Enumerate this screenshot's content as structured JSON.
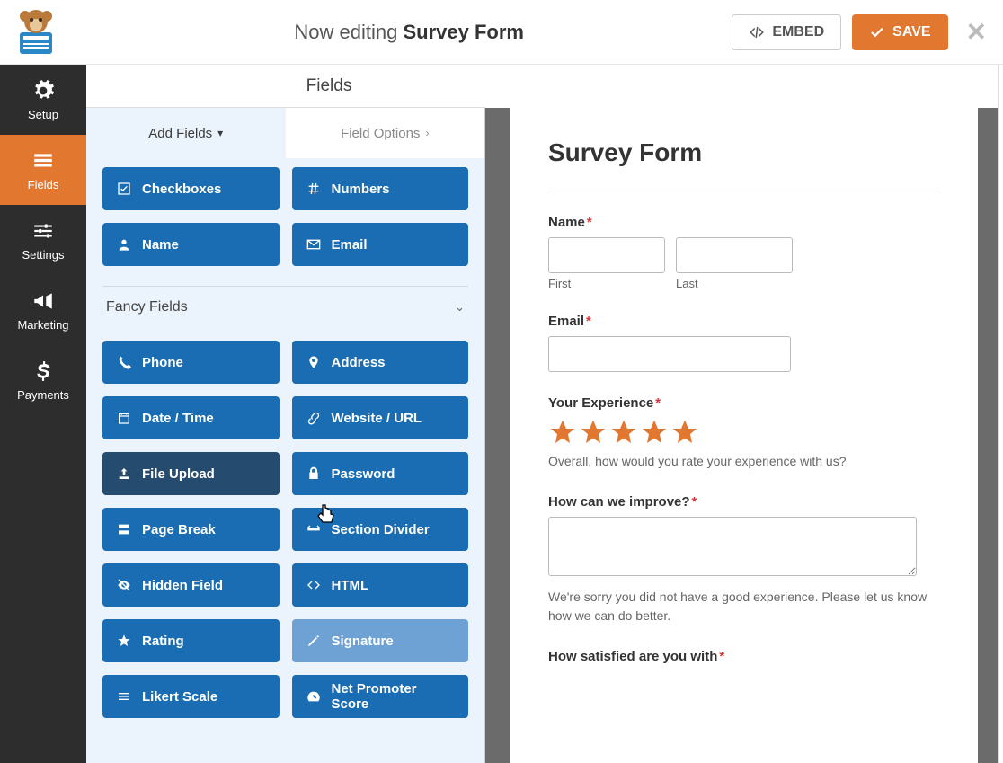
{
  "topbar": {
    "editing_prefix": "Now editing ",
    "editing_name": "Survey Form",
    "embed": "EMBED",
    "save": "SAVE"
  },
  "leftnav": [
    {
      "key": "setup",
      "label": "Setup"
    },
    {
      "key": "fields",
      "label": "Fields"
    },
    {
      "key": "settings",
      "label": "Settings"
    },
    {
      "key": "marketing",
      "label": "Marketing"
    },
    {
      "key": "payments",
      "label": "Payments"
    }
  ],
  "midheader": "Fields",
  "tabs": {
    "add": "Add Fields",
    "options": "Field Options"
  },
  "standard_fields": [
    {
      "icon": "check",
      "label": "Checkboxes"
    },
    {
      "icon": "hash",
      "label": "Numbers"
    },
    {
      "icon": "user",
      "label": "Name"
    },
    {
      "icon": "mail",
      "label": "Email"
    }
  ],
  "fancy_header": "Fancy Fields",
  "fancy_fields": [
    {
      "icon": "phone",
      "label": "Phone"
    },
    {
      "icon": "pin",
      "label": "Address"
    },
    {
      "icon": "cal",
      "label": "Date / Time"
    },
    {
      "icon": "link",
      "label": "Website / URL"
    },
    {
      "icon": "upload",
      "label": "File Upload",
      "hov": true
    },
    {
      "icon": "lock",
      "label": "Password"
    },
    {
      "icon": "break",
      "label": "Page Break"
    },
    {
      "icon": "divider",
      "label": "Section Divider"
    },
    {
      "icon": "eye",
      "label": "Hidden Field"
    },
    {
      "icon": "code",
      "label": "HTML"
    },
    {
      "icon": "star",
      "label": "Rating"
    },
    {
      "icon": "pencil",
      "label": "Signature",
      "dim": true
    },
    {
      "icon": "bars",
      "label": "Likert Scale"
    },
    {
      "icon": "gauge",
      "label": "Net Promoter Score"
    }
  ],
  "form": {
    "title": "Survey Form",
    "name_label": "Name",
    "first": "First",
    "last": "Last",
    "email_label": "Email",
    "exp_label": "Your Experience",
    "exp_help": "Overall, how would you rate your experience with us?",
    "improve_label": "How can we improve?",
    "improve_help": "We're sorry you did not have a good experience. Please let us know how we can do better.",
    "satisfied_label": "How satisfied are you with"
  }
}
